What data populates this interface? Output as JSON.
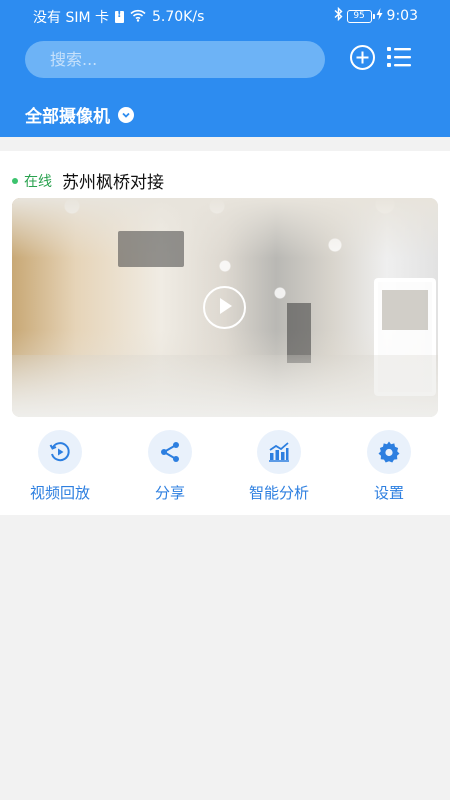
{
  "status_bar": {
    "carrier": "没有 SIM 卡",
    "network_speed": "5.70K/s",
    "battery_level": "95",
    "time": "9:03",
    "icons": [
      "sim-alert-icon",
      "wifi-icon",
      "bluetooth-icon",
      "battery-icon",
      "charging-icon"
    ]
  },
  "header": {
    "search_placeholder": "搜索...",
    "add_icon": "plus-circle-icon",
    "menu_icon": "list-icon",
    "camera_filter_label": "全部摄像机",
    "accent_color": "#2d8cf0"
  },
  "camera": {
    "status": "在线",
    "status_color": "#2aa24f",
    "name": "苏州枫桥对接",
    "play_icon": "play-icon"
  },
  "actions": [
    {
      "label": "视频回放",
      "icon": "playback-icon"
    },
    {
      "label": "分享",
      "icon": "share-icon"
    },
    {
      "label": "智能分析",
      "icon": "analytics-chart-icon"
    },
    {
      "label": "设置",
      "icon": "gear-icon"
    }
  ]
}
